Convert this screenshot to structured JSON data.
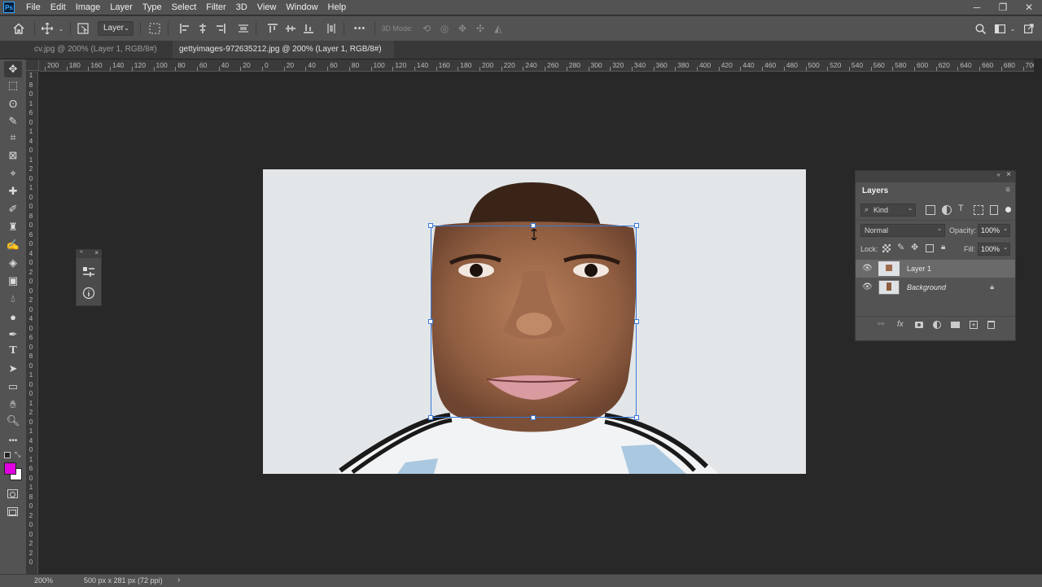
{
  "app": {
    "logo_text": "Ps"
  },
  "menu": [
    "File",
    "Edit",
    "Image",
    "Layer",
    "Type",
    "Select",
    "Filter",
    "3D",
    "View",
    "Window",
    "Help"
  ],
  "window_controls": {
    "minimize": "─",
    "restore": "❐",
    "close": "✕"
  },
  "options_bar": {
    "auto_select_target": "Layer",
    "mode_3d_label": "3D Mode:",
    "more_label": "•••"
  },
  "tabs": [
    {
      "label": "cv.jpg @ 200% (Layer 1, RGB/8#) *",
      "close": "×",
      "active": false
    },
    {
      "label": "gettyimages-972635212.jpg @ 200% (Layer 1, RGB/8#) *",
      "close": "×",
      "active": true
    }
  ],
  "ruler_h": [
    "200",
    "180",
    "160",
    "140",
    "120",
    "100",
    "80",
    "60",
    "40",
    "20",
    "0",
    "20",
    "40",
    "60",
    "80",
    "100",
    "120",
    "140",
    "160",
    "180",
    "200",
    "220",
    "240",
    "260",
    "280",
    "300",
    "320",
    "340",
    "360",
    "380",
    "400",
    "420",
    "440",
    "460",
    "480",
    "500",
    "520",
    "540",
    "560",
    "580",
    "600",
    "620",
    "640",
    "660",
    "680",
    "700"
  ],
  "ruler_v": [
    "1",
    "8",
    "0",
    "1",
    "6",
    "0",
    "1",
    "4",
    "0",
    "1",
    "2",
    "0",
    "1",
    "0",
    "0",
    "8",
    "0",
    "6",
    "0",
    "4",
    "0",
    "2",
    "0",
    "0",
    "2",
    "0",
    "4",
    "0",
    "6",
    "0",
    "8",
    "0",
    "1",
    "0",
    "0",
    "1",
    "2",
    "0",
    "1",
    "4",
    "0",
    "1",
    "6",
    "0",
    "1",
    "8",
    "0",
    "2",
    "0",
    "0",
    "2",
    "2",
    "0"
  ],
  "tools": [
    "move-tool",
    "artboard-marquee-tool",
    "lasso-tool",
    "quick-selection-tool",
    "crop-tool",
    "frame-tool",
    "eyedropper-tool",
    "spot-healing-tool",
    "brush-tool",
    "clone-stamp-tool",
    "history-brush-tool",
    "eraser-tool",
    "gradient-tool",
    "blur-tool",
    "dodge-tool",
    "pen-tool",
    "type-tool",
    "path-selection-tool",
    "rectangle-tool",
    "hand-tool",
    "zoom-tool",
    "edit-toolbar"
  ],
  "tool_glyphs": {
    "type-tool": "T",
    "edit-toolbar": "•••"
  },
  "colors": {
    "foreground": "#e000e0",
    "background": "#ffffff",
    "accent": "#31a8ff",
    "transform_box": "#3a78d8"
  },
  "layers_panel": {
    "title": "Layers",
    "filter_kind": "Kind",
    "blend_mode": "Normal",
    "opacity_label": "Opacity:",
    "opacity_value": "100%",
    "lock_label": "Lock:",
    "fill_label": "Fill:",
    "fill_value": "100%",
    "layers": [
      {
        "name": "Layer 1",
        "selected": true,
        "locked": false
      },
      {
        "name": "Background",
        "selected": false,
        "locked": true
      }
    ],
    "footer_icons": [
      "link-icon",
      "fx-icon",
      "mask-icon",
      "adjustment-icon",
      "group-icon",
      "new-layer-icon",
      "trash-icon"
    ],
    "fx_label": "fx"
  },
  "status": {
    "zoom": "200%",
    "doc_info": "500 px x 281 px (72 ppi)",
    "arrow": "›"
  }
}
